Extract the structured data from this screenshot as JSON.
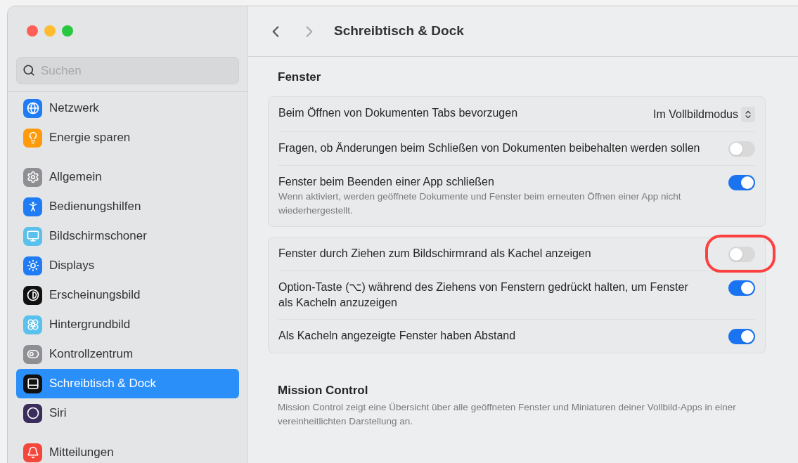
{
  "window": {
    "title": "Schreibtisch & Dock"
  },
  "sidebar": {
    "search": {
      "placeholder": "Suchen"
    },
    "groups": [
      [
        {
          "label": "Netzwerk",
          "color": "#1f7cf5",
          "selected": false
        },
        {
          "label": "Energie sparen",
          "color": "#ff9a0a",
          "selected": false
        }
      ],
      [
        {
          "label": "Allgemein",
          "color": "#8e8e93",
          "selected": false
        },
        {
          "label": "Bedienungshilfen",
          "color": "#1f7cf5",
          "selected": false
        },
        {
          "label": "Bildschirmschoner",
          "color": "#5ac0ec",
          "selected": false
        },
        {
          "label": "Displays",
          "color": "#1f7cf5",
          "selected": false
        },
        {
          "label": "Erscheinungsbild",
          "color": "#111111",
          "selected": false
        },
        {
          "label": "Hintergrundbild",
          "color": "#5ac0ec",
          "selected": false
        },
        {
          "label": "Kontrollzentrum",
          "color": "#8e8e93",
          "selected": false
        },
        {
          "label": "Schreibtisch & Dock",
          "color": "#111111",
          "selected": true
        },
        {
          "label": "Siri",
          "color": "#3a2d5c",
          "selected": false
        }
      ],
      [
        {
          "label": "Mitteilungen",
          "color": "#f4473c",
          "selected": false
        }
      ]
    ]
  },
  "sections": [
    {
      "title": "Fenster",
      "cards": [
        [
          {
            "kind": "select",
            "label": "Beim Öffnen von Dokumenten Tabs bevorzugen",
            "value": "Im Vollbildmodus"
          },
          {
            "kind": "toggle",
            "label": "Fragen, ob Änderungen beim Schließen von Dokumenten beibehalten werden sollen",
            "on": false,
            "highlighted": false
          },
          {
            "kind": "toggle",
            "label": "Fenster beim Beenden einer App schließen",
            "description": "Wenn aktiviert, werden geöffnete Dokumente und Fenster beim erneuten Öffnen einer App nicht wiederhergestellt.",
            "on": true,
            "highlighted": false
          }
        ],
        [
          {
            "kind": "toggle",
            "label": "Fenster durch Ziehen zum Bildschirmrand als Kachel anzeigen",
            "on": false,
            "highlighted": true
          },
          {
            "kind": "toggle",
            "label": "Option-Taste (⌥) während des Ziehens von Fenstern gedrückt halten, um Fenster als Kacheln anzuzeigen",
            "on": true,
            "highlighted": false
          },
          {
            "kind": "toggle",
            "label": "Als Kacheln angezeigte Fenster haben Abstand",
            "on": true,
            "highlighted": false
          }
        ]
      ]
    },
    {
      "title": "Mission Control",
      "description": "Mission Control zeigt eine Übersicht über alle geöffneten Fenster und Miniaturen deiner Vollbild-Apps in einer vereinheitlichten Darstellung an."
    }
  ]
}
